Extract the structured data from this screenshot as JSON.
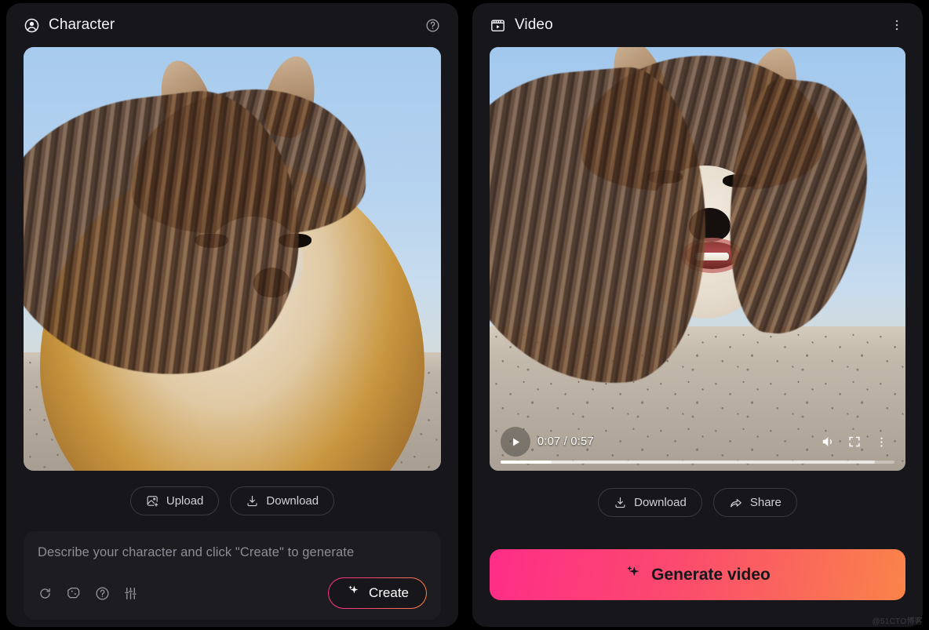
{
  "theme": {
    "page_bg": "#000000",
    "panel_bg": "#17171b",
    "prompt_bg": "#1c1c21",
    "accent_pink": "#ff2d87",
    "accent_orange": "#fa8449",
    "text_primary": "#f2f2f4",
    "text_muted": "#8d8d96",
    "pill_border": "#3a3a42"
  },
  "character_panel": {
    "title": "Character",
    "title_icon": "user-circle-icon",
    "help_icon": "help-circle-icon",
    "image_alt": "Shiba Inu dog with long flowing brown hair sitting in a desert under a blue sky",
    "buttons": [
      {
        "label": "Upload",
        "icon": "image-plus-icon"
      },
      {
        "label": "Download",
        "icon": "download-icon"
      }
    ],
    "prompt": {
      "placeholder": "Describe your character and click \"Create\" to generate",
      "value": "",
      "tools": [
        {
          "name": "refresh-icon"
        },
        {
          "name": "dice-random-icon"
        },
        {
          "name": "help-circle-icon"
        },
        {
          "name": "sliders-settings-icon"
        }
      ],
      "create_button": {
        "label": "Create",
        "icon": "sparkle-icon"
      }
    }
  },
  "video_panel": {
    "title": "Video",
    "title_icon": "video-clip-icon",
    "menu_icon": "more-vertical-icon",
    "image_alt": "Generated video frame of the Shiba Inu with long hair and a human-like mouth speaking",
    "player": {
      "play_icon": "play-icon",
      "current_time": "0:07",
      "separator": "/",
      "duration": "0:57",
      "time_display": "0:07 / 0:57",
      "volume_icon": "volume-on-icon",
      "fullscreen_icon": "fullscreen-icon",
      "menu_icon": "more-vertical-icon",
      "progress_percent": 13,
      "buffered_percent": 95
    },
    "buttons": [
      {
        "label": "Download",
        "icon": "download-icon"
      },
      {
        "label": "Share",
        "icon": "share-arrow-icon"
      }
    ],
    "generate_button": {
      "label": "Generate video",
      "icon": "sparkle-icon"
    }
  },
  "watermark": {
    "text": "@51CTO博客"
  }
}
